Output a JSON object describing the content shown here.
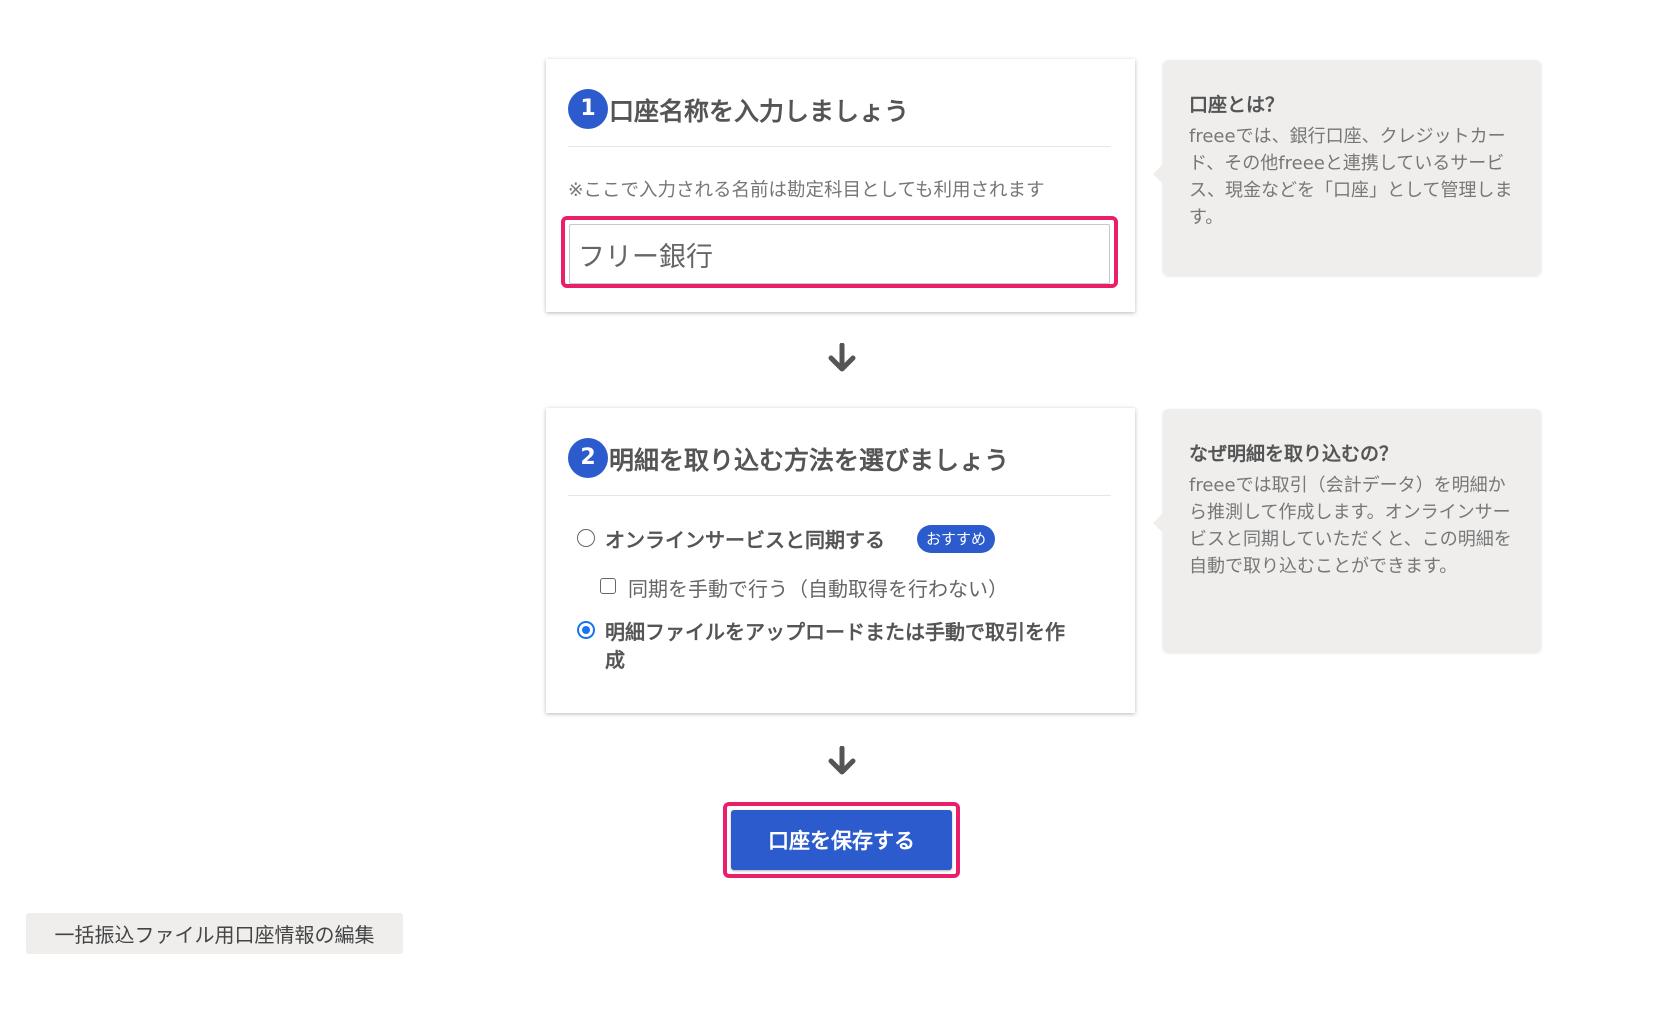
{
  "step1": {
    "number": "1",
    "title": "口座名称を入力しましょう",
    "note": "※ここで入力される名前は勘定科目としても利用されます",
    "input_value": "フリー銀行"
  },
  "help1": {
    "title": "口座とは？",
    "body": "freeeでは、銀行口座、クレジットカード、その他freeeと連携しているサービス、現金などを「口座」として管理します。"
  },
  "step2": {
    "number": "2",
    "title": "明細を取り込む方法を選びましょう",
    "option_online": "オンラインサービスと同期する",
    "badge": "おすすめ",
    "option_manual_sync": "同期を手動で行う（自動取得を行わない）",
    "option_upload_line1": "明細ファイルをアップロードまたは手動で取引を作",
    "option_upload_line2": "成",
    "selected_option": "upload"
  },
  "help2": {
    "title": "なぜ明細を取り込むの？",
    "body": "freeeでは取引（会計データ）を明細から推測して作成します。オンラインサービスと同期していただくと、この明細を自動で取り込むことができます。"
  },
  "save_button": "口座を保存する",
  "bulk_button": "一括振込ファイル用口座情報の編集",
  "icons": {
    "arrow": "arrow-down-icon"
  },
  "colors": {
    "accent": "#2c5bcd",
    "highlight": "#ea1f6a",
    "help_bg": "#efeeed"
  }
}
